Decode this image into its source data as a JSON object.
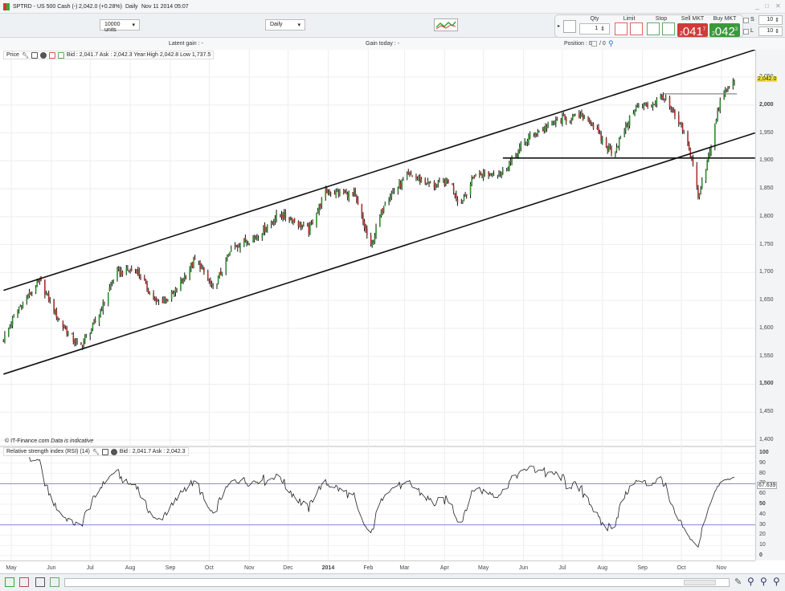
{
  "window": {
    "title": "SPTRD - US 500 Cash (-)",
    "quote": "2,042.0 (+0.28%)",
    "timeframe": "Daily",
    "datetime": "Nov 11 2014 05:07"
  },
  "toolbar": {
    "units": "10000 units",
    "period": "Daily"
  },
  "trade_panel": {
    "qty_label": "Qty",
    "qty_value": "1",
    "limit_label": "Limit",
    "stop_label": "Stop",
    "sell_label": "Sell MKT",
    "sell_big": "041",
    "sell_prefix": "2",
    "sell_sup": "7",
    "buy_label": "Buy MKT",
    "buy_big": "042",
    "buy_prefix": "2",
    "buy_sup": "3",
    "s_label": "S",
    "s_value": "10",
    "l_label": "L",
    "l_value": "10",
    "sell_color": "#d23a3a",
    "buy_color": "#3a9a3a"
  },
  "info": {
    "latent_gain": "Latent gain : -",
    "gain_today": "Gain today : -",
    "position": "Position : 0",
    "position2": "/ 0"
  },
  "price_panel": {
    "label": "Price",
    "stats": "Bid : 2,041.7 Ask : 2,042.3 Year:High 2,042.8 Low 1,737.5",
    "copyright": "© IT-Finance.com",
    "disclaimer": "Data is indicative",
    "current_tag": "2,042.0"
  },
  "rsi_panel": {
    "label": "Relative strength index (RSI) (14)",
    "stats": "Bid : 2,041.7 Ask : 2,042.3",
    "current_tag": "67.639"
  },
  "chart_data": [
    {
      "type": "candlestick",
      "title": "SPTRD - US 500 Cash (-) Daily",
      "ylim": [
        1400,
        2050
      ],
      "yticks": [
        "2,050",
        "2,000",
        "1,950",
        "1,900",
        "1,850",
        "1,800",
        "1,750",
        "1,700",
        "1,650",
        "1,600",
        "1,550",
        "1,500",
        "1,450",
        "1,400"
      ],
      "ytick_values": [
        2050,
        2000,
        1950,
        1900,
        1850,
        1800,
        1750,
        1700,
        1650,
        1600,
        1550,
        1500,
        1450,
        1400
      ],
      "xrange": [
        "2013-04-25",
        "2014-11-27"
      ],
      "xticks": [
        {
          "label": "May",
          "date": "2013-05-01"
        },
        {
          "label": "Jun",
          "date": "2013-06-01"
        },
        {
          "label": "Jul",
          "date": "2013-07-01"
        },
        {
          "label": "Aug",
          "date": "2013-08-01"
        },
        {
          "label": "Sep",
          "date": "2013-09-01"
        },
        {
          "label": "Oct",
          "date": "2013-10-01"
        },
        {
          "label": "Nov",
          "date": "2013-11-01"
        },
        {
          "label": "Dec",
          "date": "2013-12-01"
        },
        {
          "label": "2014",
          "date": "2014-01-01"
        },
        {
          "label": "Feb",
          "date": "2014-02-01"
        },
        {
          "label": "Mar",
          "date": "2014-03-01"
        },
        {
          "label": "Apr",
          "date": "2014-04-01"
        },
        {
          "label": "May",
          "date": "2014-05-01"
        },
        {
          "label": "Jun",
          "date": "2014-06-01"
        },
        {
          "label": "Jul",
          "date": "2014-07-01"
        },
        {
          "label": "Aug",
          "date": "2014-08-01"
        },
        {
          "label": "Sep",
          "date": "2014-09-01"
        },
        {
          "label": "Oct",
          "date": "2014-10-01"
        },
        {
          "label": "Nov",
          "date": "2014-11-01"
        }
      ],
      "close_waypoints": [
        [
          "2013-04-25",
          1580
        ],
        [
          "2013-05-05",
          1630
        ],
        [
          "2013-05-23",
          1685
        ],
        [
          "2013-06-08",
          1610
        ],
        [
          "2013-06-23",
          1565
        ],
        [
          "2013-07-06",
          1615
        ],
        [
          "2013-07-21",
          1700
        ],
        [
          "2013-08-06",
          1705
        ],
        [
          "2013-08-21",
          1645
        ],
        [
          "2013-09-03",
          1660
        ],
        [
          "2013-09-21",
          1725
        ],
        [
          "2013-10-04",
          1670
        ],
        [
          "2013-10-19",
          1745
        ],
        [
          "2013-11-07",
          1765
        ],
        [
          "2013-11-24",
          1805
        ],
        [
          "2013-12-05",
          1795
        ],
        [
          "2013-12-17",
          1775
        ],
        [
          "2013-12-30",
          1845
        ],
        [
          "2014-01-21",
          1840
        ],
        [
          "2014-02-03",
          1745
        ],
        [
          "2014-02-14",
          1830
        ],
        [
          "2014-03-05",
          1875
        ],
        [
          "2014-03-24",
          1855
        ],
        [
          "2014-04-05",
          1865
        ],
        [
          "2014-04-13",
          1820
        ],
        [
          "2014-04-24",
          1875
        ],
        [
          "2014-05-16",
          1880
        ],
        [
          "2014-06-06",
          1945
        ],
        [
          "2014-07-01",
          1975
        ],
        [
          "2014-07-20",
          1980
        ],
        [
          "2014-08-04",
          1925
        ],
        [
          "2014-08-10",
          1915
        ],
        [
          "2014-08-26",
          1995
        ],
        [
          "2014-09-07",
          2000
        ],
        [
          "2014-09-17",
          2015
        ],
        [
          "2014-10-02",
          1955
        ],
        [
          "2014-10-12",
          1880
        ],
        [
          "2014-10-14",
          1830
        ],
        [
          "2014-10-21",
          1900
        ],
        [
          "2014-11-01",
          2015
        ],
        [
          "2014-11-11",
          2042
        ]
      ],
      "trendlines": [
        {
          "name": "upper-channel",
          "from": [
            "2013-04-25",
            1668
          ],
          "to": [
            "2014-11-27",
            2099
          ]
        },
        {
          "name": "lower-channel",
          "from": [
            "2013-04-25",
            1518
          ],
          "to": [
            "2014-11-27",
            1950
          ]
        },
        {
          "name": "support",
          "from": [
            "2014-05-16",
            1905
          ],
          "to": [
            "2014-11-27",
            1905
          ]
        },
        {
          "name": "resistance",
          "from": [
            "2014-09-17",
            2020
          ],
          "to": [
            "2014-11-13",
            2020
          ]
        }
      ],
      "last": 2042.0
    },
    {
      "type": "line",
      "title": "Relative strength index (RSI) (14)",
      "ylim": [
        0,
        100
      ],
      "yticks": [
        "100",
        "90",
        "80",
        "70",
        "60",
        "50",
        "40",
        "30",
        "20",
        "10",
        "0"
      ],
      "ytick_values": [
        100,
        90,
        80,
        70,
        60,
        50,
        40,
        30,
        20,
        10,
        0
      ],
      "levels": [
        70,
        30
      ],
      "last": 67.639,
      "level_color": "#8a86e0"
    }
  ]
}
